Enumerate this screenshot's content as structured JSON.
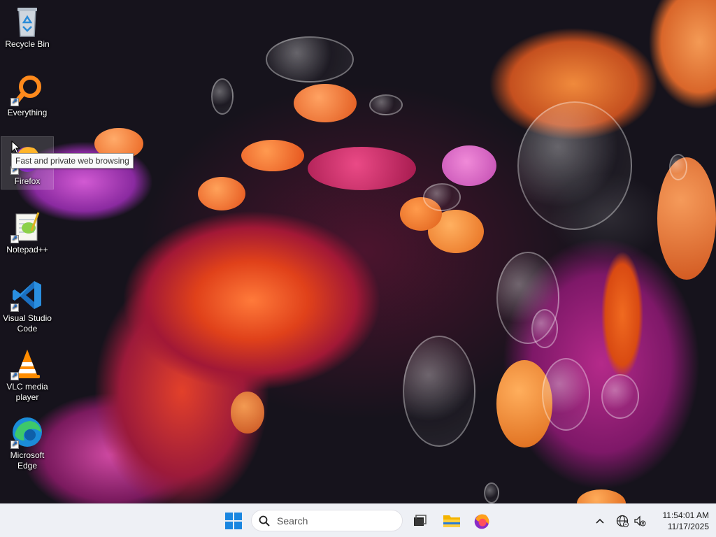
{
  "desktop": {
    "icons": [
      {
        "label": "Recycle Bin",
        "icon": "recycle-bin-icon",
        "shortcut": false
      },
      {
        "label": "Everything",
        "icon": "everything-search-icon",
        "shortcut": true
      },
      {
        "label": "Firefox",
        "icon": "firefox-icon",
        "shortcut": true
      },
      {
        "label": "Notepad++",
        "icon": "notepad-plus-plus-icon",
        "shortcut": true
      },
      {
        "label": "Visual Studio Code",
        "icon": "vscode-icon",
        "shortcut": true
      },
      {
        "label": "VLC media player",
        "icon": "vlc-icon",
        "shortcut": true
      },
      {
        "label": "Microsoft Edge",
        "icon": "edge-icon",
        "shortcut": true
      }
    ],
    "tooltip": "Fast and private web browsing"
  },
  "taskbar": {
    "search": {
      "placeholder": "Search"
    },
    "pinned": [
      "start-icon",
      "task-view-icon",
      "file-explorer-icon",
      "firefox-icon"
    ],
    "tray": [
      "chevron-up-icon",
      "network-globe-icon",
      "volume-muted-icon"
    ],
    "clock": {
      "time": "11:54:01 AM",
      "date": "11/17/2025"
    }
  },
  "colors": {
    "accent": "#0078d4",
    "taskbar_bg": "#eef0f5",
    "wallpaper_bg": "#16131c"
  }
}
